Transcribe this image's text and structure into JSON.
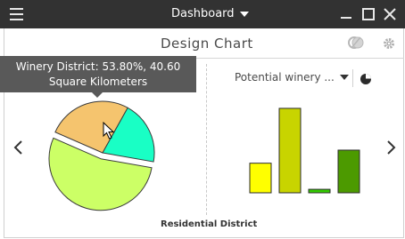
{
  "window": {
    "title": "Dashboard",
    "menu_icon": "hamburger-menu-icon",
    "controls": [
      "minimize-icon",
      "maximize-icon",
      "close-icon"
    ]
  },
  "panel": {
    "title": "Design Chart",
    "icons": [
      "filter-toggle-icon",
      "settings-gear-icon"
    ]
  },
  "tooltip": {
    "line1": "Winery District: 53.80%, 40.60",
    "line2": "Square Kilometers"
  },
  "right_panel": {
    "dropdown_label": "Potential winery ...",
    "chart_type_icon": "pie-chart-icon"
  },
  "nav": {
    "prev": "chevron-left-icon",
    "next": "chevron-right-icon"
  },
  "chart_data": [
    {
      "type": "pie",
      "title": "",
      "slices": [
        {
          "label": "Winery District",
          "percent": 53.8,
          "value": 40.6,
          "color": "#ccff66",
          "exploded": true
        },
        {
          "label": "",
          "percent": 26.5,
          "color": "#f5c46e"
        },
        {
          "label": "",
          "percent": 19.7,
          "color": "#19ffc5"
        }
      ]
    },
    {
      "type": "bar",
      "xlabel": "Residential District",
      "categories": [
        "",
        "",
        "",
        ""
      ],
      "values": [
        34,
        97,
        4,
        49
      ],
      "colors": [
        "#ffff00",
        "#c8d400",
        "#33cc00",
        "#4c9a00"
      ],
      "ylim": [
        0,
        100
      ]
    }
  ]
}
